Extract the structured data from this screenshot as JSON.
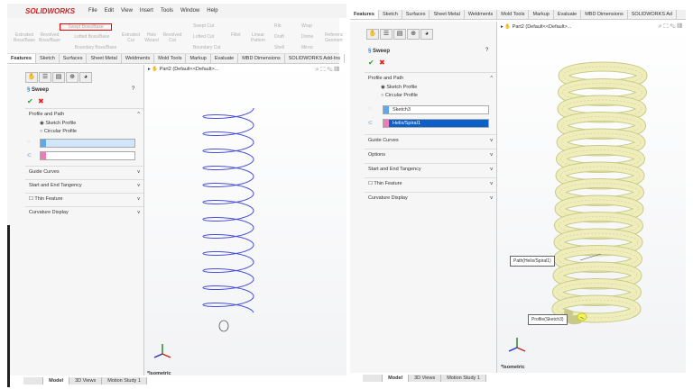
{
  "left": {
    "app": "SOLIDWORKS",
    "menu": [
      "File",
      "Edit",
      "View",
      "Insert",
      "Tools",
      "Window",
      "Help"
    ],
    "ribbon": {
      "extruded_boss": "Extruded Boss/Base",
      "revolved_boss": "Revolved Boss/Base",
      "swept_boss": "Swept Boss/Base",
      "lofted_boss": "Lofted Boss/Base",
      "boundary_boss": "Boundary Boss/Base",
      "extruded_cut": "Extruded Cut",
      "hole_wizard": "Hole Wizard",
      "revolved_cut": "Revolved Cut",
      "swept_cut": "Swept Cut",
      "lofted_cut": "Lofted Cut",
      "boundary_cut": "Boundary Cut",
      "fillet": "Fillet",
      "linear_pattern": "Linear Pattern",
      "rib": "Rib",
      "draft": "Draft",
      "shell": "Shell",
      "wrap": "Wrap",
      "dome": "Dome",
      "mirror": "Mirror",
      "ref_geom": "Reference Geometry"
    },
    "tabs": [
      "Features",
      "Sketch",
      "Surfaces",
      "Sheet Metal",
      "Weldments",
      "Mold Tools",
      "Markup",
      "Evaluate",
      "MBD Dimensions",
      "SOLIDWORKS Add-Ins",
      "MB"
    ],
    "tree": "Part2  (Default<<Default>...",
    "pm": {
      "title": "Sweep",
      "profile_path": "Profile and Path",
      "sketch_profile": "Sketch Profile",
      "circular_profile": "Circular Profile",
      "profile_value": "",
      "path_value": "",
      "sections": [
        "Guide Curves",
        "Start and End Tangency",
        "Thin Feature",
        "Curvature Display"
      ]
    },
    "view_name": "*Isometric",
    "bottom_tabs": [
      "Model",
      "3D Views",
      "Motion Study 1"
    ]
  },
  "right": {
    "tabs": [
      "Features",
      "Sketch",
      "Surfaces",
      "Sheet Metal",
      "Weldments",
      "Mold Tools",
      "Markup",
      "Evaluate",
      "MBD Dimensions",
      "SOLIDWORKS Ad"
    ],
    "tree": "Part2  (Default<<Default>...",
    "pm": {
      "title": "Sweep",
      "profile_path": "Profile and Path",
      "sketch_profile": "Sketch Profile",
      "circular_profile": "Circular Profile",
      "profile_value": "Sketch3",
      "path_value": "Helix/Spiral1",
      "sections": [
        "Guide Curves",
        "Options",
        "Start and End Tangency",
        "Thin Feature",
        "Curvature Display"
      ]
    },
    "callouts": {
      "path": "Path(Helix/Spiral1)",
      "profile": "Profile(Sketch3)"
    },
    "view_name": "*Isometric",
    "bottom_tabs": [
      "Model",
      "3D Views",
      "Motion Study 1"
    ]
  },
  "colors": {
    "helix": "#4a4fd8",
    "sweep": "#eeeebb",
    "selected": "#0a5fc8",
    "profile_swatch": "#5aa8f0",
    "path_swatch": "#f07ab8"
  }
}
